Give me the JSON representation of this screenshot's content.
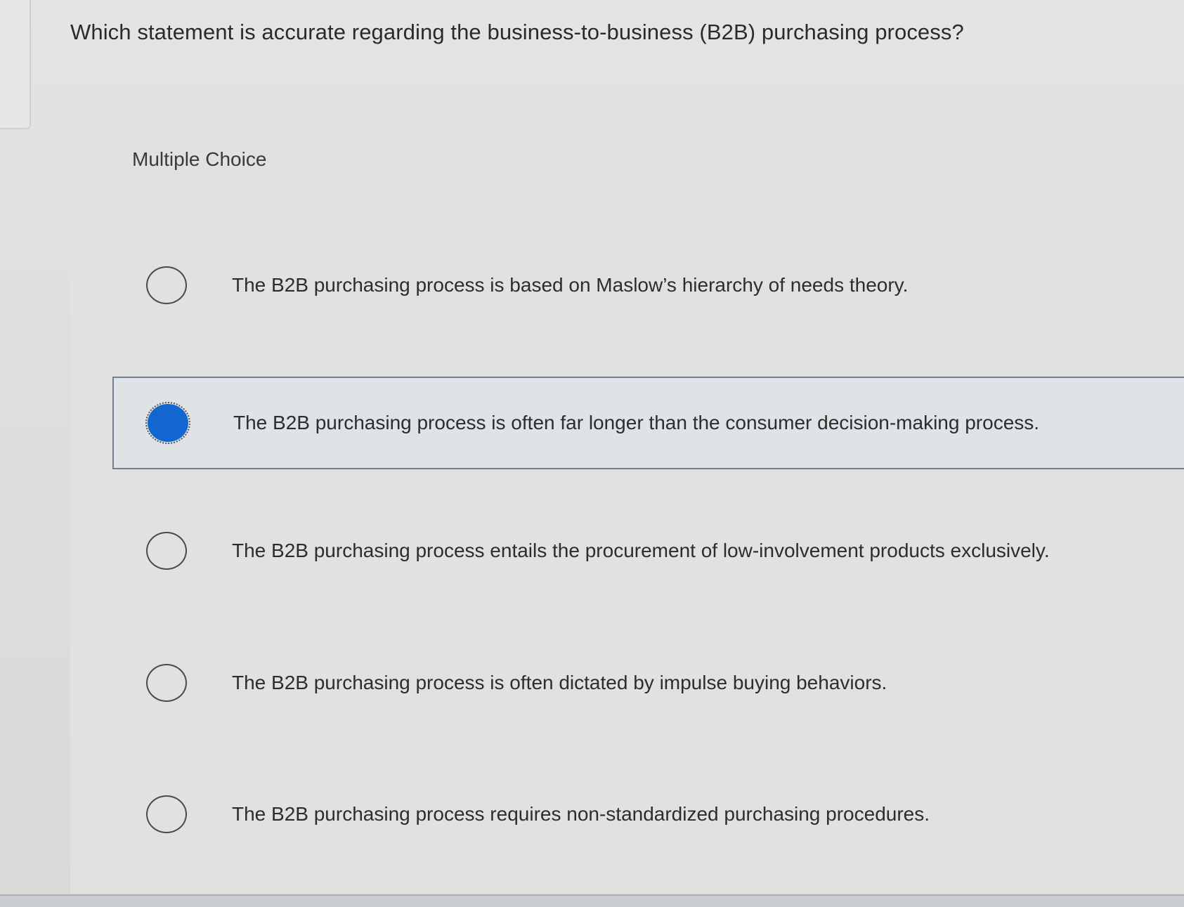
{
  "question": {
    "text": "Which statement is accurate regarding the business-to-business (B2B) purchasing process?"
  },
  "choice_type_label": "Multiple Choice",
  "options": [
    {
      "text": "The B2B purchasing process is based on Maslow’s hierarchy of needs theory.",
      "selected": false
    },
    {
      "text": "The B2B purchasing process is often far longer than the consumer decision-making process.",
      "selected": true
    },
    {
      "text": "The B2B purchasing process entails the procurement of low-involvement products exclusively.",
      "selected": false
    },
    {
      "text": "The B2B purchasing process is often dictated by impulse buying behaviors.",
      "selected": false
    },
    {
      "text": "The B2B purchasing process requires non-standardized purchasing procedures.",
      "selected": false
    }
  ],
  "colors": {
    "selected_radio": "#1366d0",
    "selected_border": "#6f7f90"
  }
}
